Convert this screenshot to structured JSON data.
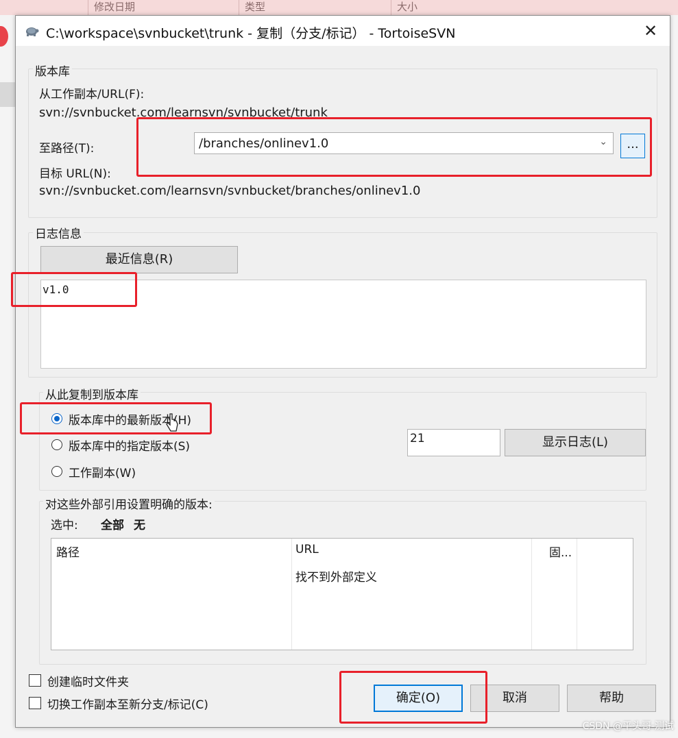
{
  "background": {
    "columns": [
      "修改日期",
      "类型",
      "大小"
    ]
  },
  "window": {
    "title": "C:\\workspace\\svnbucket\\trunk - 复制（分支/标记） - TortoiseSVN",
    "close_glyph": "✕",
    "icon": "tortoise-icon"
  },
  "repository": {
    "group_label": "版本库",
    "from_label": "从工作副本/URL(F):",
    "from_url": "svn://svnbucket.com/learnsvn/svnbucket/trunk",
    "to_path_label": "至路径(T):",
    "to_path_value": "/branches/onlinev1.0",
    "browse_button": "...",
    "target_url_label": "目标 URL(N):",
    "target_url": "svn://svnbucket.com/learnsvn/svnbucket/branches/onlinev1.0"
  },
  "log": {
    "group_label": "日志信息",
    "recent_button": "最近信息(R)",
    "message": "v1.0"
  },
  "copy_from": {
    "group_label": "从此复制到版本库",
    "options": [
      {
        "label": "版本库中的最新版本(H)",
        "selected": true
      },
      {
        "label": "版本库中的指定版本(S)",
        "selected": false
      },
      {
        "label": "工作副本(W)",
        "selected": false
      }
    ],
    "revision_value": "21",
    "show_log_button": "显示日志(L)"
  },
  "externals": {
    "group_label": "对这些外部引用设置明确的版本:",
    "select_label": "选中:",
    "select_all": "全部",
    "select_none": "无",
    "columns": [
      "路径",
      "URL",
      "固..."
    ],
    "empty_message": "找不到外部定义"
  },
  "footer": {
    "create_temp_folder": "创建临时文件夹",
    "switch_working_copy": "切换工作副本至新分支/标记(C)",
    "ok_button": "确定(O)",
    "cancel_button": "取消",
    "help_button": "帮助"
  },
  "watermark": "CSDN @平头哥-测试",
  "colors": {
    "highlight": "#e8202a",
    "accent": "#0078d7"
  }
}
